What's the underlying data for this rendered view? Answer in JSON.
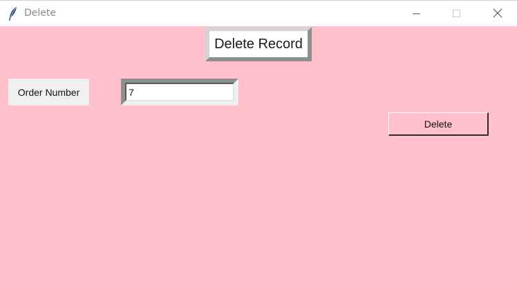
{
  "window": {
    "title": "Delete",
    "icon": "feather-icon",
    "controls": [
      "minimize-icon",
      "maximize-icon",
      "close-icon"
    ]
  },
  "form": {
    "heading": "Delete Record",
    "order_number_label": "Order Number",
    "order_number_value": "7",
    "delete_button_label": "Delete"
  },
  "colors": {
    "background": "#ffc0cb",
    "label_background": "#f0f0f0"
  }
}
